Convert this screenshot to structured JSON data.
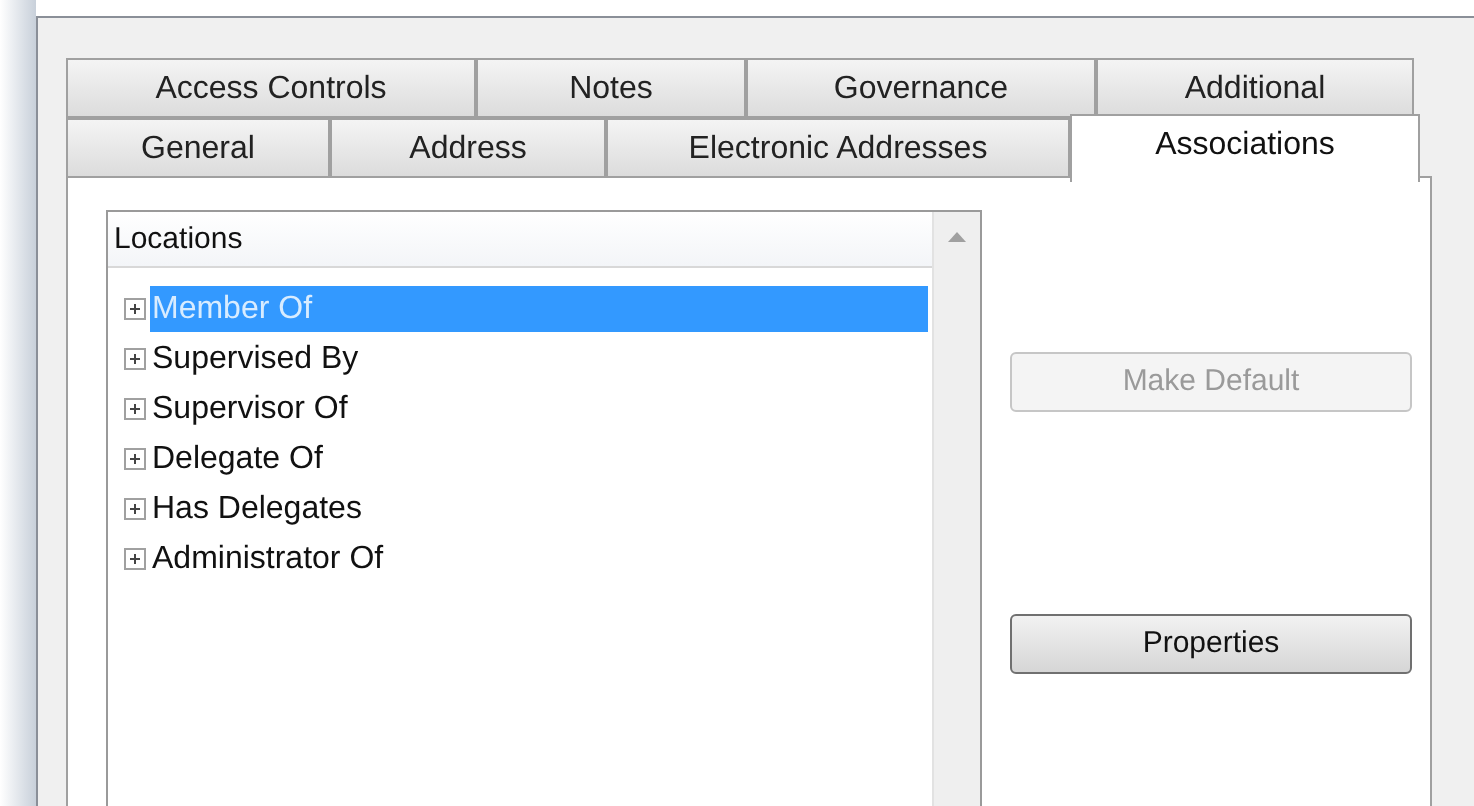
{
  "tab_rows": [
    [
      {
        "label": "Access Controls",
        "selected": false
      },
      {
        "label": "Notes",
        "selected": false
      },
      {
        "label": "Governance",
        "selected": false
      },
      {
        "label": "Additional",
        "selected": false
      }
    ],
    [
      {
        "label": "General",
        "selected": false
      },
      {
        "label": "Address",
        "selected": false
      },
      {
        "label": "Electronic Addresses",
        "selected": false
      },
      {
        "label": "Associations",
        "selected": true
      }
    ]
  ],
  "tree": {
    "header": "Locations",
    "items": [
      {
        "label": "Member Of",
        "expanded": false,
        "selected": true
      },
      {
        "label": "Supervised By",
        "expanded": false,
        "selected": false
      },
      {
        "label": "Supervisor Of",
        "expanded": false,
        "selected": false
      },
      {
        "label": "Delegate Of",
        "expanded": false,
        "selected": false
      },
      {
        "label": "Has Delegates",
        "expanded": false,
        "selected": false
      },
      {
        "label": "Administrator Of",
        "expanded": false,
        "selected": false
      }
    ]
  },
  "buttons": [
    {
      "label": "Make Default",
      "disabled": true
    },
    {
      "label": "Properties",
      "disabled": false
    }
  ]
}
